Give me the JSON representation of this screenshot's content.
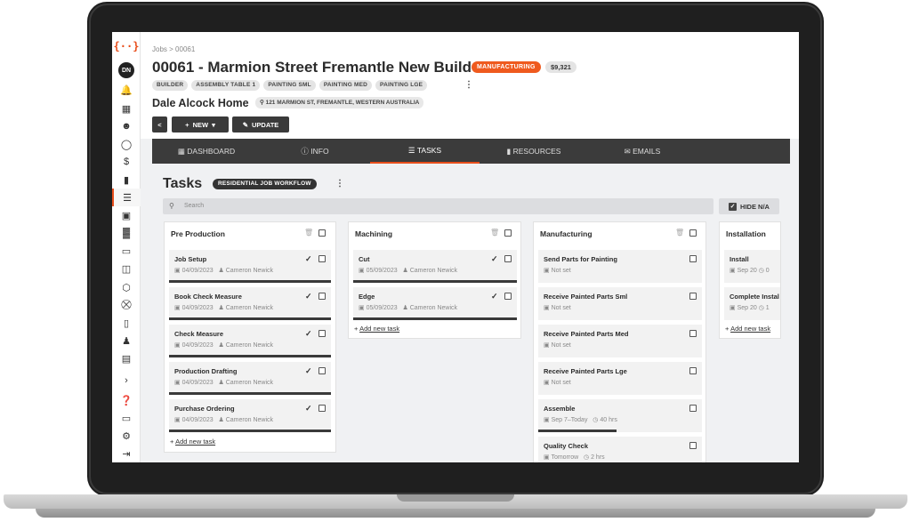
{
  "breadcrumb": {
    "parent": "Jobs",
    "sep": ">",
    "current": "00061"
  },
  "job": {
    "title": "00061 - Marmion Street Fremantle New Build",
    "status": "MANUFACTURING",
    "price": "$9,321",
    "tags": [
      "BUILDER",
      "ASSEMBLY TABLE 1",
      "PAINTING SML",
      "PAINTING MED",
      "PAINTING LGE"
    ],
    "customer": "Dale Alcock Home",
    "address": "121 MARMION ST, FREMANTLE, WESTERN AUSTRALIA"
  },
  "toolbar": {
    "back": "<",
    "new_label": "NEW",
    "update_label": "UPDATE"
  },
  "tabs": [
    {
      "label": "DASHBOARD",
      "icon": "grid-icon"
    },
    {
      "label": "INFO",
      "icon": "info-icon"
    },
    {
      "label": "TASKS",
      "icon": "list-icon",
      "active": true
    },
    {
      "label": "RESOURCES",
      "icon": "folder-icon"
    },
    {
      "label": "EMAILS",
      "icon": "mail-icon"
    }
  ],
  "tasks_view": {
    "title": "Tasks",
    "workflow": "RESIDENTIAL JOB WORKFLOW",
    "search_placeholder": "Search",
    "hide_na": "HIDE N/A",
    "add_task": "Add new task"
  },
  "columns": [
    {
      "title": "Pre Production",
      "tasks": [
        {
          "name": "Job Setup",
          "date": "04/09/2023",
          "user": "Cameron Newick",
          "done": true
        },
        {
          "name": "Book Check Measure",
          "date": "04/09/2023",
          "user": "Cameron Newick",
          "done": true
        },
        {
          "name": "Check Measure",
          "date": "04/09/2023",
          "user": "Cameron Newick",
          "done": true
        },
        {
          "name": "Production Drafting",
          "date": "04/09/2023",
          "user": "Cameron Newick",
          "done": true
        },
        {
          "name": "Purchase Ordering",
          "date": "04/09/2023",
          "user": "Cameron Newick",
          "done": true
        }
      ]
    },
    {
      "title": "Machining",
      "tasks": [
        {
          "name": "Cut",
          "date": "05/09/2023",
          "user": "Cameron Newick",
          "done": true
        },
        {
          "name": "Edge",
          "date": "05/09/2023",
          "user": "Cameron Newick",
          "done": true
        }
      ]
    },
    {
      "title": "Manufacturing",
      "tasks": [
        {
          "name": "Send Parts for Painting",
          "date": "Not set",
          "user": "",
          "done": false
        },
        {
          "name": "Receive Painted Parts Sml",
          "date": "Not set",
          "user": "",
          "done": false
        },
        {
          "name": "Receive Painted Parts Med",
          "date": "Not set",
          "user": "",
          "done": false
        },
        {
          "name": "Receive Painted Parts Lge",
          "date": "Not set",
          "user": "",
          "done": false
        },
        {
          "name": "Assemble",
          "date": "Sep 7–Today",
          "user": "40 hrs",
          "done": false,
          "progress": 0.48
        },
        {
          "name": "Quality Check",
          "date": "Tomorrow",
          "user": "2 hrs",
          "done": false
        }
      ]
    },
    {
      "title": "Installation",
      "tasks": [
        {
          "name": "Install",
          "date": "Sep 20",
          "user": "0",
          "done": false
        },
        {
          "name": "Complete Instal",
          "date": "Sep 20",
          "user": "1",
          "done": false
        }
      ]
    }
  ],
  "sidebar": {
    "logo": "{··}",
    "avatar": "DN"
  }
}
